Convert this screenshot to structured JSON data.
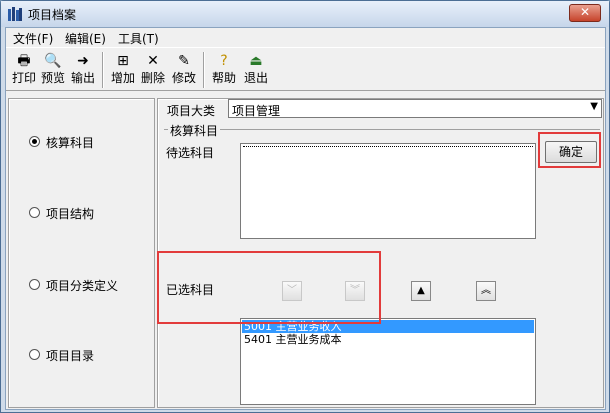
{
  "window": {
    "title": "项目档案",
    "close_label": "✕"
  },
  "menu": [
    "文件(F)",
    "编辑(E)",
    "工具(T)"
  ],
  "toolbar": [
    {
      "label": "打印",
      "icon": "print-icon"
    },
    {
      "label": "预览",
      "icon": "preview-icon"
    },
    {
      "label": "输出",
      "icon": "export-icon"
    },
    {
      "label": "增加",
      "icon": "add-icon"
    },
    {
      "label": "删除",
      "icon": "delete-icon"
    },
    {
      "label": "修改",
      "icon": "edit-icon"
    },
    {
      "label": "帮助",
      "icon": "help-icon"
    },
    {
      "label": "退出",
      "icon": "exit-icon"
    }
  ],
  "left_options": [
    {
      "label": "核算科目",
      "checked": true
    },
    {
      "label": "项目结构",
      "checked": false
    },
    {
      "label": "项目分类定义",
      "checked": false
    },
    {
      "label": "项目目录",
      "checked": false
    }
  ],
  "category": {
    "label": "项目大类",
    "value": "项目管理"
  },
  "group_title": "核算科目",
  "pending_label": "待选科目",
  "confirm_button": "确定",
  "selected_label": "已选科目",
  "selected_items": [
    {
      "code": "5001",
      "name": "主营业务收入",
      "selected": true
    },
    {
      "code": "5401",
      "name": "主营业务成本",
      "selected": false
    }
  ],
  "colors": {
    "highlight": "#e23b3b",
    "selection": "#3399ff"
  }
}
